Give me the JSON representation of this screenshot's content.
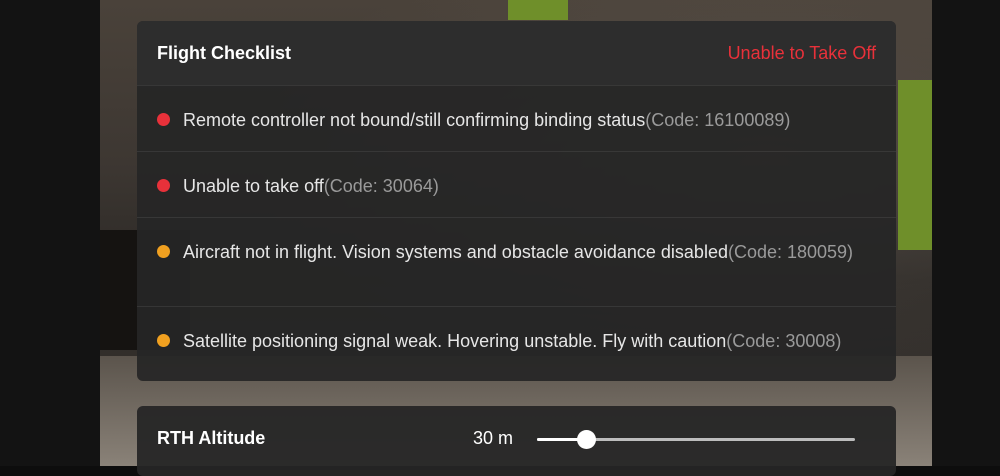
{
  "checklist": {
    "title": "Flight Checklist",
    "status": "Unable to Take Off",
    "status_color": "#e8313a",
    "items": [
      {
        "severity": "error",
        "color": "#e8313a",
        "message": "Remote controller not bound/still confirming binding status",
        "code": "(Code: 16100089)"
      },
      {
        "severity": "error",
        "color": "#e8313a",
        "message": "Unable to take off",
        "code": "(Code: 30064)"
      },
      {
        "severity": "warning",
        "color": "#f0a020",
        "message": "Aircraft not in flight. Vision systems and obstacle avoidance disabled",
        "code": "(Code: 180059)"
      },
      {
        "severity": "warning",
        "color": "#f0a020",
        "message": "Satellite positioning signal weak. Hovering unstable. Fly with caution",
        "code": "(Code: 30008)"
      }
    ]
  },
  "rth": {
    "label": "RTH Altitude",
    "value": "30 m",
    "slider_fraction": 0.155
  }
}
